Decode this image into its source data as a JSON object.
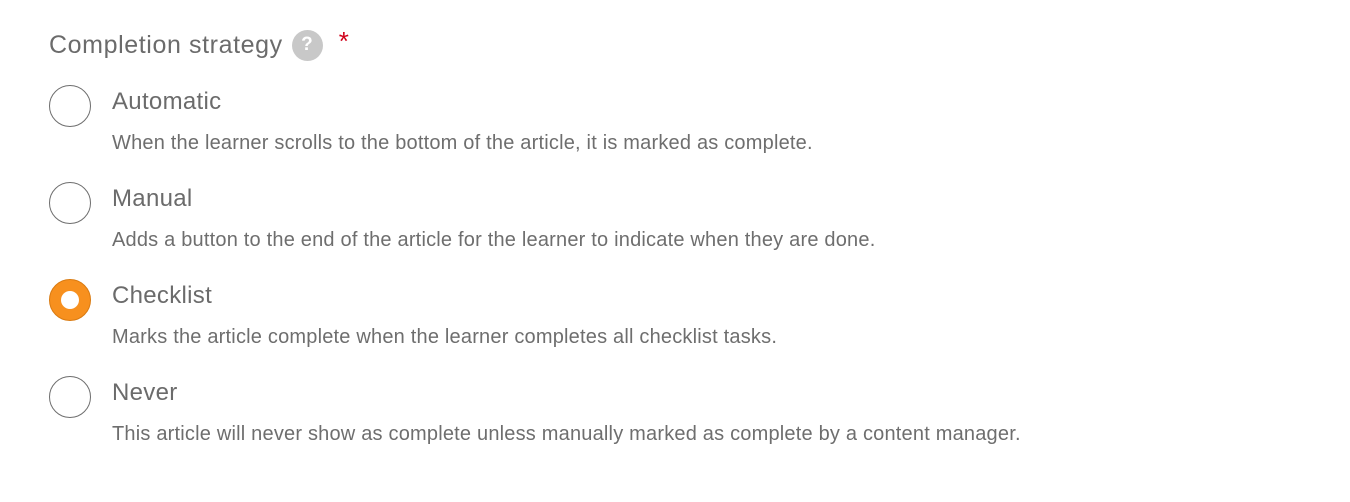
{
  "field": {
    "label": "Completion strategy",
    "help_icon_glyph": "?",
    "help_icon_name": "question-mark-icon",
    "required_mark": "*",
    "required_color": "#d0021b"
  },
  "options": [
    {
      "title": "Automatic",
      "description": "When the learner scrolls to the bottom of the article, it is marked as complete.",
      "selected": false
    },
    {
      "title": "Manual",
      "description": "Adds a button to the end of the article for the learner to indicate when they are done.",
      "selected": false
    },
    {
      "title": "Checklist",
      "description": "Marks the article complete when the learner completes all checklist tasks.",
      "selected": true
    },
    {
      "title": "Never",
      "description": "This article will never show as complete unless manually marked as complete by a content manager.",
      "selected": false
    }
  ],
  "colors": {
    "accent": "#f7901e",
    "text": "#6b6b6b"
  }
}
